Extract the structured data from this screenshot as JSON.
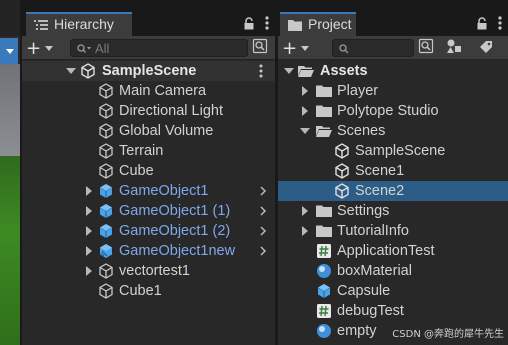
{
  "hierarchy": {
    "tab_label": "Hierarchy",
    "search_placeholder": "All",
    "scene_name": "SampleScene",
    "items": [
      {
        "label": "Main Camera",
        "type": "object"
      },
      {
        "label": "Directional Light",
        "type": "object"
      },
      {
        "label": "Global Volume",
        "type": "object"
      },
      {
        "label": "Terrain",
        "type": "object"
      },
      {
        "label": "Cube",
        "type": "object"
      },
      {
        "label": "GameObject1",
        "type": "prefab"
      },
      {
        "label": "GameObject1 (1)",
        "type": "prefab"
      },
      {
        "label": "GameObject1 (2)",
        "type": "prefab"
      },
      {
        "label": "GameObject1new",
        "type": "prefab-variant"
      },
      {
        "label": "vectortest1",
        "type": "object-collapsed"
      },
      {
        "label": "Cube1",
        "type": "object"
      }
    ]
  },
  "project": {
    "tab_label": "Project",
    "search_placeholder": "",
    "root": "Assets",
    "items": [
      {
        "label": "Player",
        "type": "folder",
        "depth": 1
      },
      {
        "label": "Polytope Studio",
        "type": "folder",
        "depth": 1
      },
      {
        "label": "Scenes",
        "type": "folder-open",
        "depth": 1
      },
      {
        "label": "SampleScene",
        "type": "scene",
        "depth": 2
      },
      {
        "label": "Scene1",
        "type": "scene",
        "depth": 2
      },
      {
        "label": "Scene2",
        "type": "scene",
        "depth": 2,
        "selected": true
      },
      {
        "label": "Settings",
        "type": "folder",
        "depth": 1
      },
      {
        "label": "TutorialInfo",
        "type": "folder",
        "depth": 1
      },
      {
        "label": "ApplicationTest",
        "type": "script",
        "depth": 1
      },
      {
        "label": "boxMaterial",
        "type": "material",
        "depth": 1
      },
      {
        "label": "Capsule",
        "type": "prefab",
        "depth": 1
      },
      {
        "label": "debugTest",
        "type": "script",
        "depth": 1
      },
      {
        "label": "empty",
        "type": "material",
        "depth": 1
      }
    ]
  },
  "watermark": "CSDN @奔跑的犀牛先生",
  "colors": {
    "accent": "#3a79bb",
    "selection": "#2c5d87",
    "prefab_text": "#7fa8ec",
    "panel_bg": "#282828"
  }
}
